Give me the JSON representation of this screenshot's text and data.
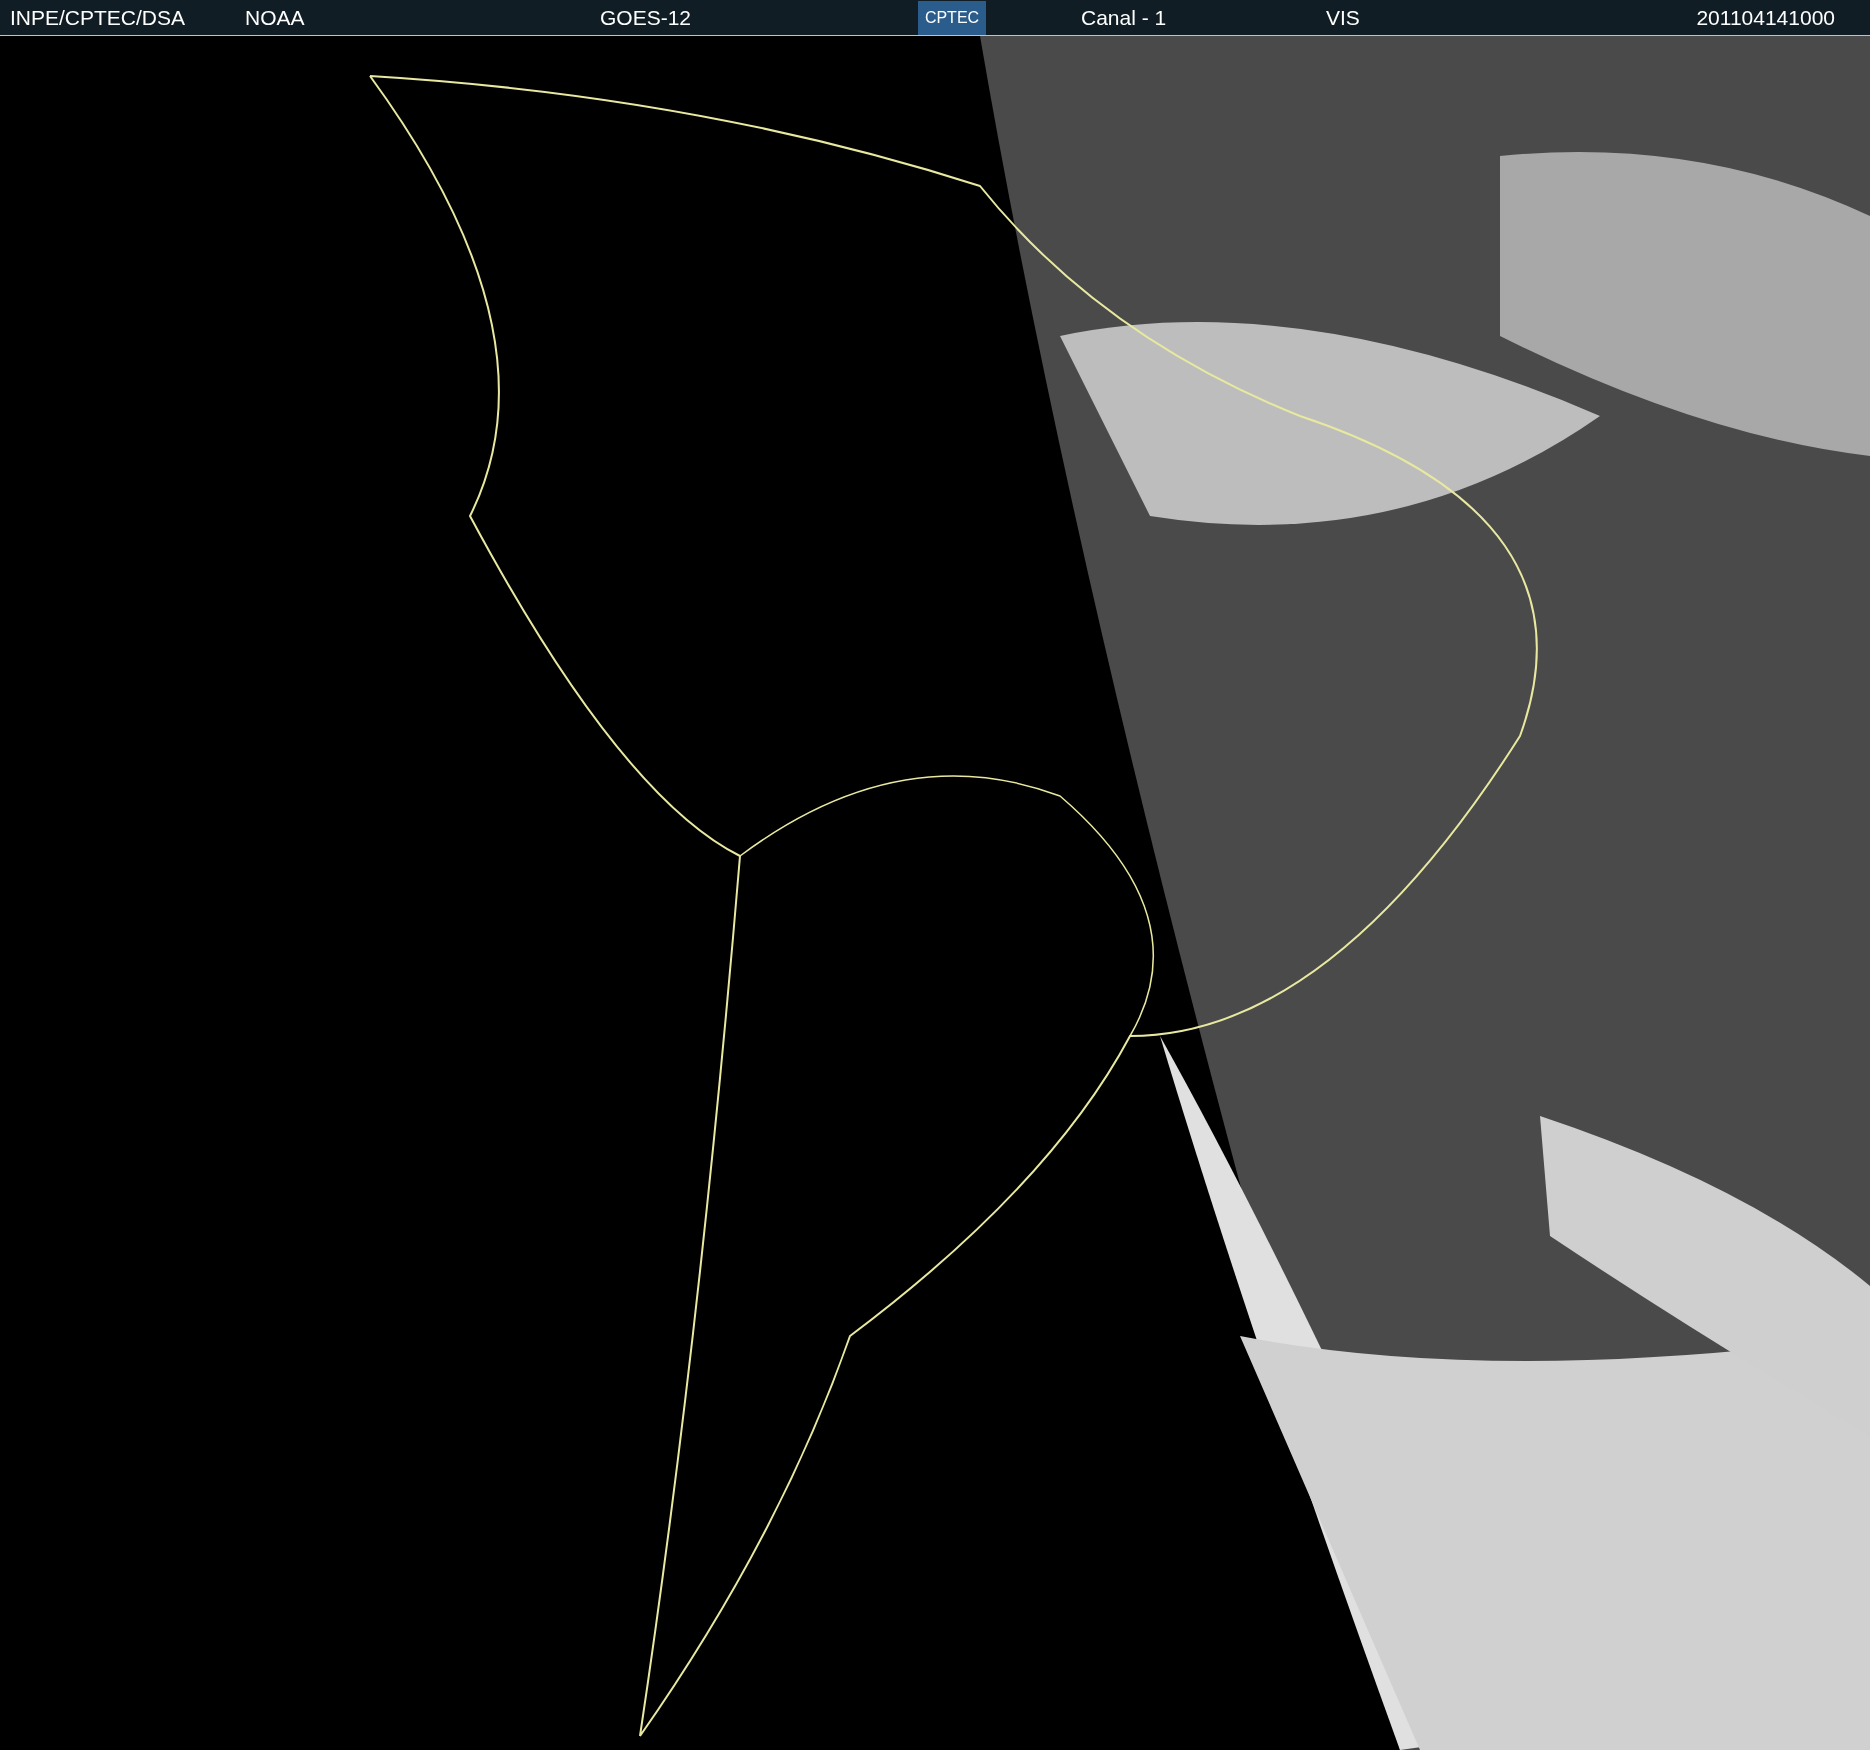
{
  "header": {
    "source": "INPE/CPTEC/DSA",
    "agency": "NOAA",
    "satellite": "GOES-12",
    "logo": "CPTEC",
    "channel": "Canal - 1",
    "band": "VIS",
    "timestamp": "201104141000"
  }
}
